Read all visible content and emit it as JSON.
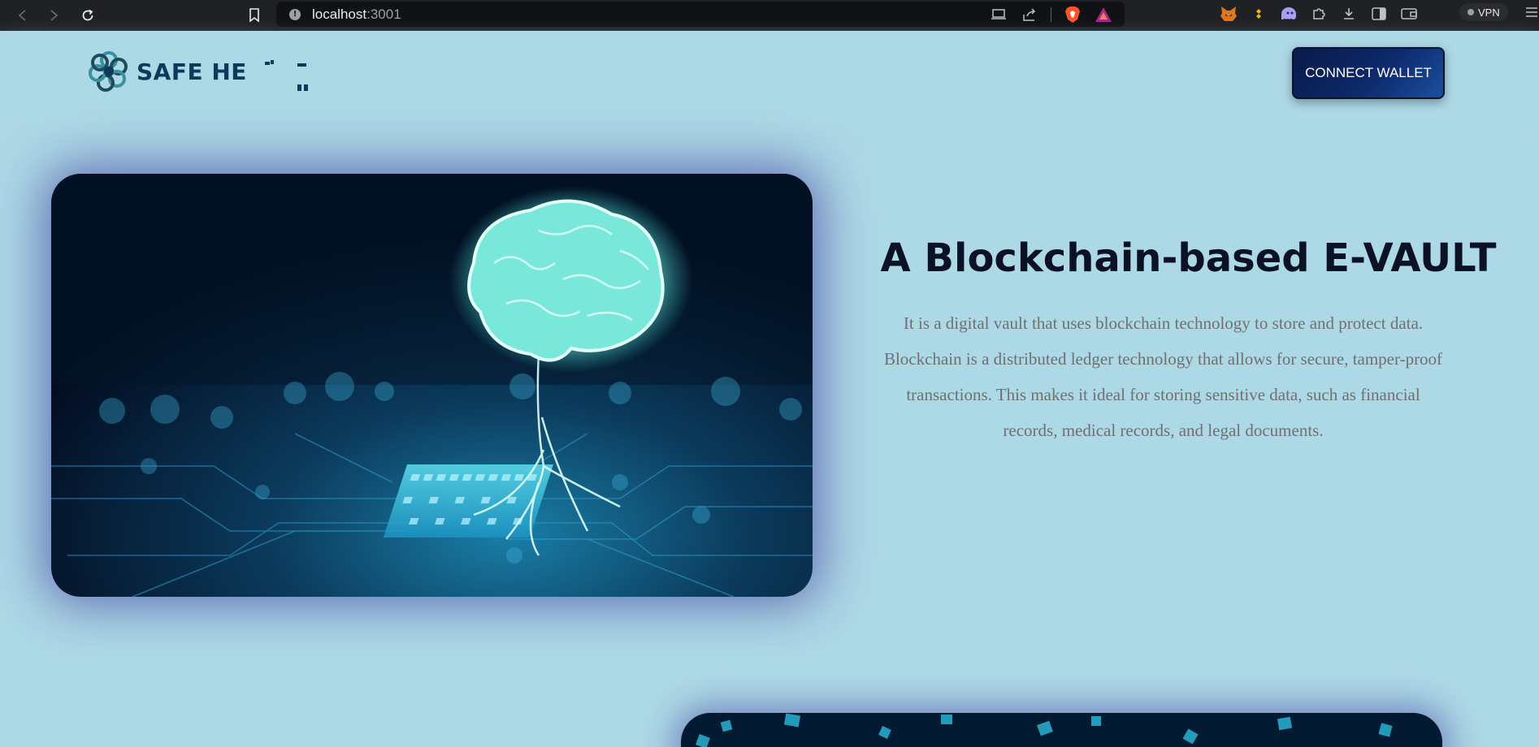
{
  "browser": {
    "url_host": "localhost",
    "url_port": ":3001",
    "vpn_label": "VPN"
  },
  "header": {
    "logo_text": "SAFE HE",
    "connect_label": "CONNECT WALLET"
  },
  "hero": {
    "title": "A Blockchain-based E-VAULT",
    "description": "It is a digital vault that uses blockchain technology to store and protect data. Blockchain is a distributed ledger technology that allows for secure, tamper-proof transactions. This makes it ideal for storing sensitive data, such as financial records, medical records, and legal documents."
  },
  "colors": {
    "page_bg": "#add8e6",
    "button_bg": "#0d2a6b",
    "title": "#0b1226",
    "body_text": "#707070"
  }
}
